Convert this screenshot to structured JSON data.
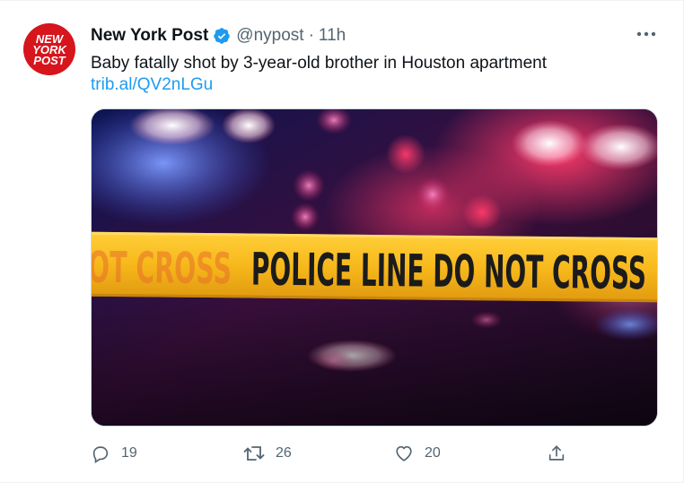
{
  "tweet": {
    "author_name": "New York Post",
    "handle": "@nypost",
    "separator": "·",
    "time": "11h",
    "text": "Baby fatally shot by 3-year-old brother in Houston apartment",
    "link": "trib.al/QV2nLGu",
    "avatar_text": [
      "NEW",
      "YORK",
      "POST"
    ],
    "media": {
      "tape_text": "POLICE LINE DO NOT CROSS",
      "tape_text_left": "OT CROSS"
    }
  },
  "actions": {
    "reply_count": "19",
    "retweet_count": "26",
    "like_count": "20"
  },
  "icons": {
    "verified": "verified-badge-icon",
    "more": "more-dots-icon",
    "reply": "reply-icon",
    "retweet": "retweet-icon",
    "like": "like-icon",
    "share": "share-icon"
  },
  "colors": {
    "accent": "#1d9bf0",
    "secondary_text": "#536471",
    "avatar_bg": "#d6151c",
    "tape": "#f7b81b"
  }
}
